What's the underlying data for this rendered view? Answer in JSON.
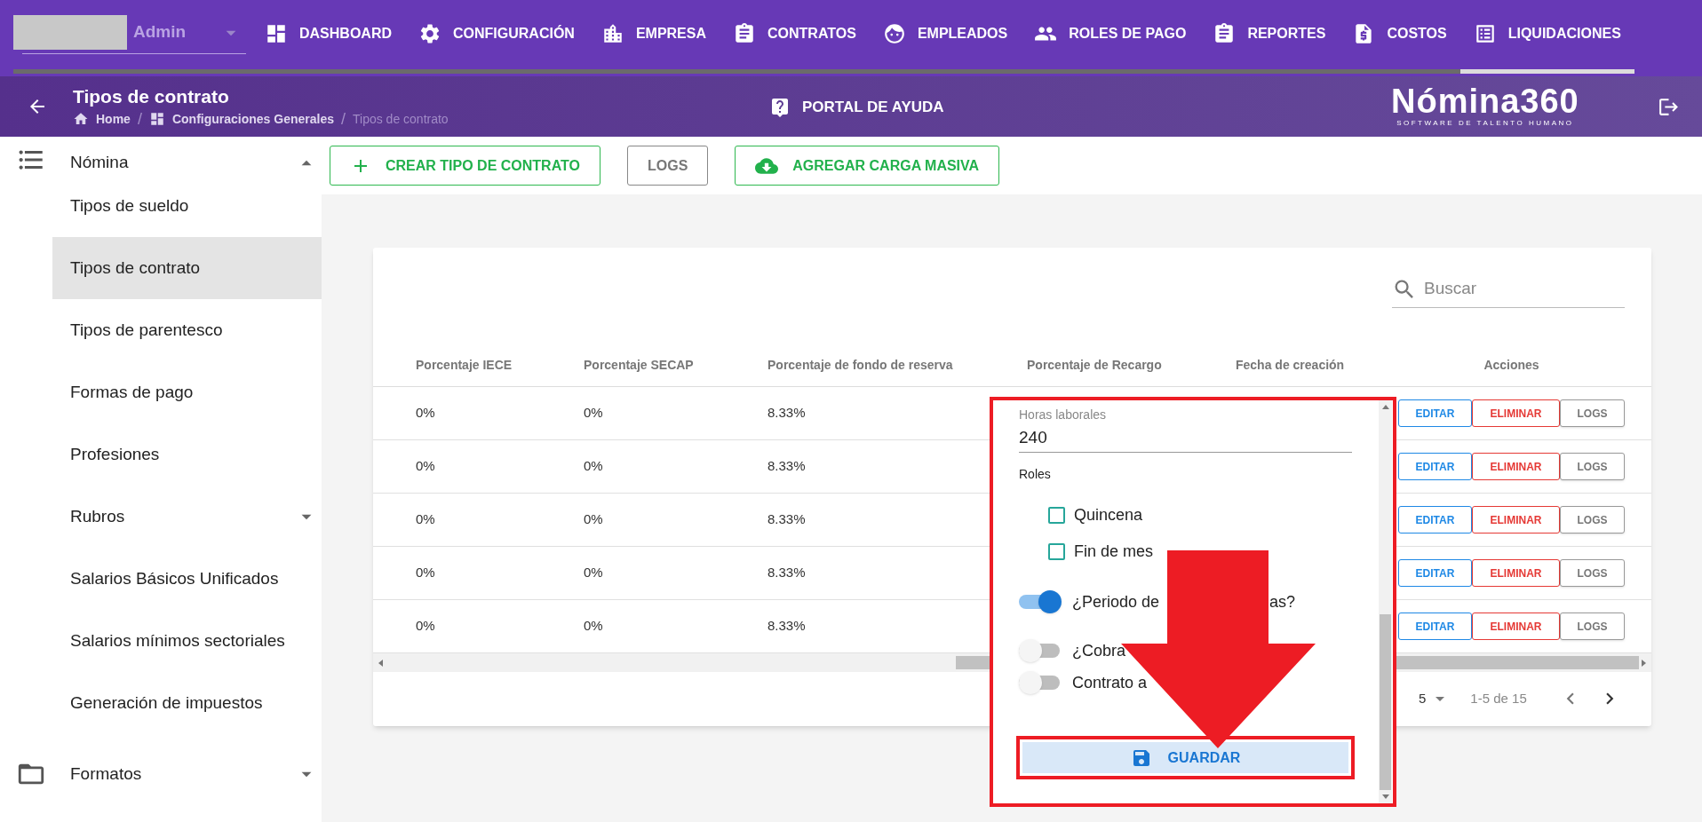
{
  "top_bar": {
    "user": "Admin",
    "nav": [
      {
        "label": "DASHBOARD",
        "selected": false
      },
      {
        "label": "CONFIGURACIÓN",
        "selected": false
      },
      {
        "label": "EMPRESA",
        "selected": false
      },
      {
        "label": "CONTRATOS",
        "selected": false
      },
      {
        "label": "EMPLEADOS",
        "selected": false
      },
      {
        "label": "ROLES DE PAGO",
        "selected": false
      },
      {
        "label": "REPORTES",
        "selected": false
      },
      {
        "label": "COSTOS",
        "selected": false
      },
      {
        "label": "LIQUIDACIONES",
        "selected": true
      }
    ]
  },
  "header": {
    "title": "Tipos de contrato",
    "breadcrumbs": [
      "Home",
      "Configuraciones Generales",
      "Tipos de contrato"
    ],
    "breadcrumb_separator": "/",
    "help_link": "PORTAL DE AYUDA",
    "logo": {
      "name": "Nómina360",
      "tagline": "SOFTWARE DE TALENTO HUMANO"
    }
  },
  "sidebar": {
    "items": [
      {
        "label": "Nómina",
        "expanded": true,
        "children": [
          {
            "label": "Tipos de sueldo",
            "selected": false
          },
          {
            "label": "Tipos de contrato",
            "selected": true
          },
          {
            "label": "Tipos de parentesco",
            "selected": false
          },
          {
            "label": "Formas de pago",
            "selected": false
          },
          {
            "label": "Profesiones",
            "selected": false
          },
          {
            "label": "Rubros",
            "selected": false,
            "expanded": false
          },
          {
            "label": "Salarios Básicos Unificados",
            "selected": false
          },
          {
            "label": "Salarios mínimos sectoriales",
            "selected": false
          },
          {
            "label": "Generación de impuestos",
            "selected": false
          }
        ]
      },
      {
        "label": "Formatos",
        "expanded": false
      }
    ]
  },
  "toolbar": {
    "buttons": [
      {
        "label": "CREAR TIPO DE CONTRATO",
        "kind": "create"
      },
      {
        "label": "LOGS",
        "kind": "plain"
      },
      {
        "label": "AGREGAR CARGA MASIVA",
        "kind": "upload"
      }
    ]
  },
  "table": {
    "search": {
      "placeholder": "Buscar"
    },
    "columns": [
      "Porcentaje IECE",
      "Porcentaje SECAP",
      "Porcentaje de fondo de reserva",
      "Porcentaje de Recargo",
      "Fecha de creación",
      "Acciones"
    ],
    "rows": [
      {
        "cells": [
          "0%",
          "0%",
          "8.33%"
        ],
        "actions": [
          "EDITAR",
          "ELIMINAR",
          "LOGS"
        ]
      },
      {
        "cells": [
          "0%",
          "0%",
          "8.33%"
        ],
        "actions": [
          "EDITAR",
          "ELIMINAR",
          "LOGS"
        ]
      },
      {
        "cells": [
          "0%",
          "0%",
          "8.33%"
        ],
        "actions": [
          "EDITAR",
          "ELIMINAR",
          "LOGS"
        ]
      },
      {
        "cells": [
          "0%",
          "0%",
          "8.33%"
        ],
        "actions": [
          "EDITAR",
          "ELIMINAR",
          "LOGS"
        ]
      },
      {
        "cells": [
          "0%",
          "0%",
          "8.33%"
        ],
        "actions": [
          "EDITAR",
          "ELIMINAR",
          "LOGS"
        ]
      }
    ],
    "pagination": {
      "rows_per_page": "5",
      "range": "1-5 de 15"
    }
  },
  "dialog": {
    "field": {
      "label": "Horas laborales",
      "value": "240"
    },
    "section": "Roles",
    "checkboxes": [
      {
        "label": "Quincena",
        "checked": false
      },
      {
        "label": "Fin de mes",
        "checked": false
      }
    ],
    "toggles": [
      {
        "label_parts": [
          "¿Periodo de",
          "as?"
        ],
        "on": true
      },
      {
        "label_parts": [
          "¿Cobra"
        ],
        "on": false
      },
      {
        "label_parts": [
          "Contrato a"
        ],
        "on": false
      }
    ],
    "save_button": "GUARDAR"
  }
}
